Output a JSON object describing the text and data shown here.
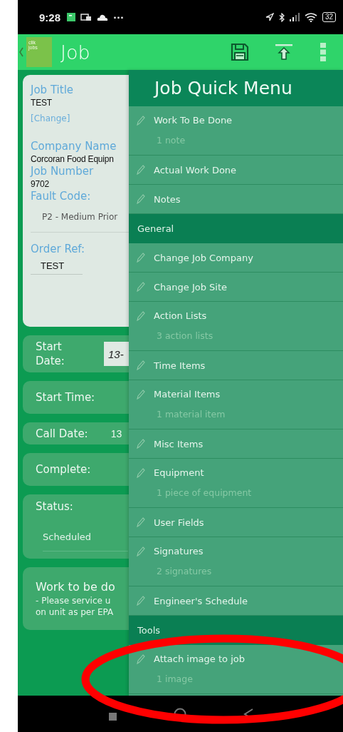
{
  "status_bar": {
    "time": "9:28",
    "overflow": "···",
    "battery": "32"
  },
  "app_bar": {
    "logo_lines": [
      "clik",
      "jobs"
    ],
    "title": "Job"
  },
  "job_details": [
    {
      "kind": "field",
      "label": "Job Title",
      "value": "TEST"
    },
    {
      "kind": "link",
      "label": "[Change]"
    },
    {
      "kind": "field",
      "label": "Company Name",
      "value": "Corcoran Food Equipn"
    },
    {
      "kind": "field",
      "label": "Job Number",
      "value": "9702"
    },
    {
      "kind": "select",
      "label": "Fault Code:",
      "value": "P2 - Medium Prior"
    },
    {
      "kind": "input",
      "label": "Order Ref:",
      "value": "TEST"
    }
  ],
  "job_rows": [
    {
      "kind": "date",
      "label": "Start Date:",
      "value": "13-"
    },
    {
      "kind": "plain",
      "label": "Start Time:"
    },
    {
      "kind": "inline",
      "label": "Call Date:",
      "value": "13"
    },
    {
      "kind": "plain",
      "label": "Complete:"
    },
    {
      "kind": "select",
      "label": "Status:",
      "value": "Scheduled"
    },
    {
      "kind": "note",
      "label": "Work to be do",
      "lines": [
        "-  Please service u",
        "on unit as per EPA"
      ]
    }
  ],
  "quick_menu": {
    "title": "Job Quick Menu",
    "entries": [
      {
        "kind": "item",
        "label": "Work To Be Done",
        "detail": "1 note"
      },
      {
        "kind": "item",
        "label": "Actual Work Done"
      },
      {
        "kind": "item",
        "label": "Notes"
      },
      {
        "kind": "section",
        "label": "General"
      },
      {
        "kind": "item",
        "label": "Change Job Company"
      },
      {
        "kind": "item",
        "label": "Change Job Site"
      },
      {
        "kind": "item",
        "label": "Action Lists",
        "detail": "3 action lists"
      },
      {
        "kind": "item",
        "label": "Time Items"
      },
      {
        "kind": "item",
        "label": "Material Items",
        "detail": "1 material item"
      },
      {
        "kind": "item",
        "label": "Misc Items"
      },
      {
        "kind": "item",
        "label": "Equipment",
        "detail": "1 piece of equipment"
      },
      {
        "kind": "item",
        "label": "User Fields"
      },
      {
        "kind": "item",
        "label": "Signatures",
        "detail": "2 signatures"
      },
      {
        "kind": "item",
        "label": "Engineer's Schedule"
      },
      {
        "kind": "section",
        "label": "Tools"
      },
      {
        "kind": "item",
        "label": "Attach image to job",
        "detail": "1 image"
      }
    ]
  },
  "annotation": {
    "color": "#ff0000"
  }
}
